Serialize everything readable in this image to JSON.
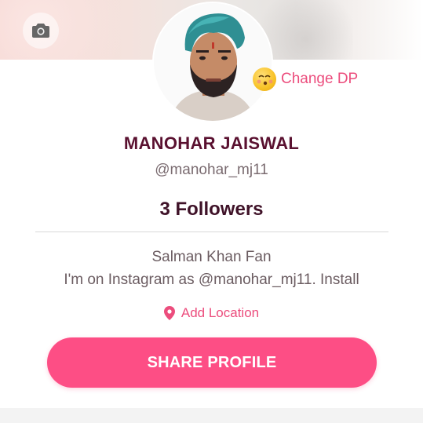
{
  "profile": {
    "name": "MANOHAR JAISWAL",
    "username": "@manohar_mj11",
    "followers": "3 Followers",
    "bio_line1": "Salman Khan Fan",
    "bio_line2": "I'm on Instagram as @manohar_mj11. Install"
  },
  "actions": {
    "change_dp": "Change DP",
    "add_location": "Add Location",
    "share_profile": "SHARE PROFILE"
  },
  "icons": {
    "camera": "camera-icon",
    "location": "location-pin-icon",
    "emoji": "kissing-face-emoji-icon"
  },
  "colors": {
    "accent": "#fd4e85",
    "link": "#ec4d7d",
    "name": "#5a1130"
  }
}
